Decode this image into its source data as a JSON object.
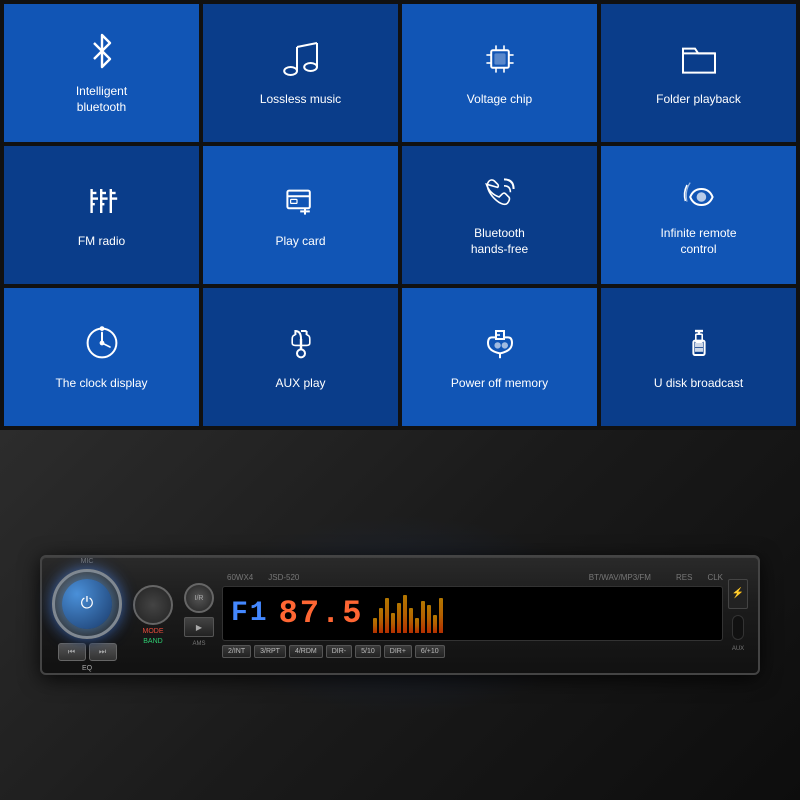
{
  "features": [
    {
      "id": "intelligent-bluetooth",
      "label": "Intelligent\nbluetooth",
      "icon": "bluetooth"
    },
    {
      "id": "lossless-music",
      "label": "Lossless music",
      "icon": "music"
    },
    {
      "id": "voltage-chip",
      "label": "Voltage chip",
      "icon": "chip"
    },
    {
      "id": "folder-playback",
      "label": "Folder playback",
      "icon": "folder"
    },
    {
      "id": "fm-radio",
      "label": "FM radio",
      "icon": "fm"
    },
    {
      "id": "play-card",
      "label": "Play card",
      "icon": "card"
    },
    {
      "id": "bluetooth-hands-free",
      "label": "Bluetooth\nhands-free",
      "icon": "phone"
    },
    {
      "id": "infinite-remote",
      "label": "Infinite remote\ncontrol",
      "icon": "remote"
    },
    {
      "id": "clock-display",
      "label": "The clock display",
      "icon": "clock"
    },
    {
      "id": "aux-play",
      "label": "AUX play",
      "icon": "aux"
    },
    {
      "id": "power-off-memory",
      "label": "Power off memory",
      "icon": "memory"
    },
    {
      "id": "u-disk",
      "label": "U disk broadcast",
      "icon": "usb"
    }
  ],
  "stereo": {
    "model": "JSD-520",
    "power": "60WX4",
    "display_mode": "F1",
    "display_freq": "87.5",
    "labels": {
      "mic": "MIC",
      "mode": "MODE",
      "band": "BAND",
      "res": "RES",
      "clk": "CLK",
      "bt_wav_mp3_fm": "BT/WAV/MP3/FM",
      "ams": "AMS",
      "eq": "EQ",
      "ir": "I/R",
      "aux": "AUX"
    },
    "buttons": [
      "2/INT",
      "3/RPT",
      "4/RDM",
      "DIR-",
      "5/10",
      "DIR+",
      "6/+10"
    ]
  }
}
